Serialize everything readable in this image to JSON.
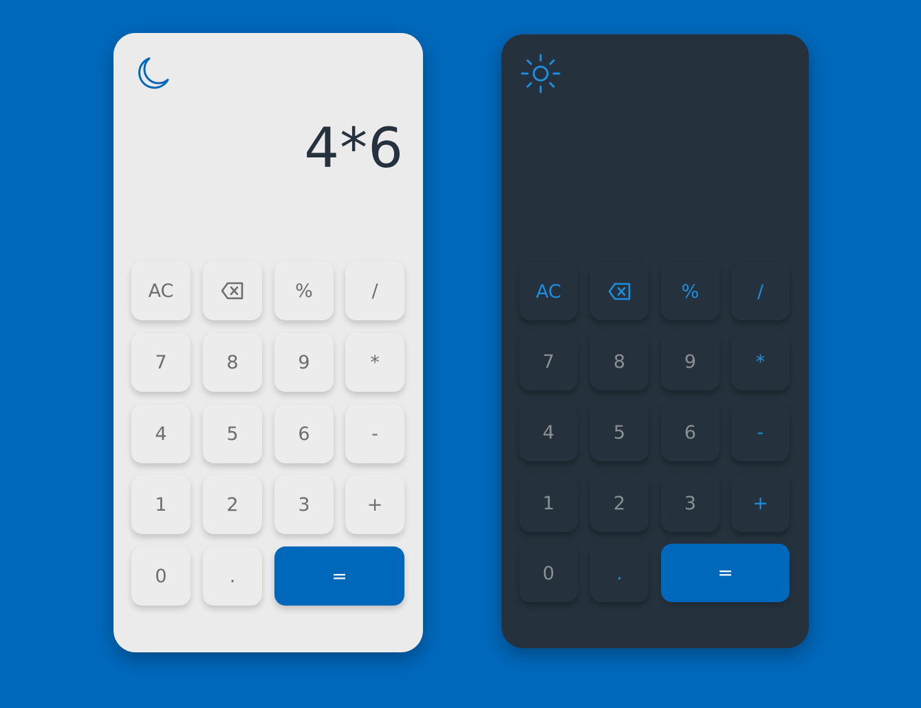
{
  "colors": {
    "background": "#0068bb",
    "light_panel": "#ebebeb",
    "dark_panel": "#25323d",
    "accent": "#0068bb",
    "dark_operator": "#1c8fe0"
  },
  "light_calculator": {
    "theme_icon": "moon-icon",
    "display": "4*6",
    "keys": {
      "ac": "AC",
      "backspace_icon": "backspace-icon",
      "percent": "%",
      "divide": "/",
      "seven": "7",
      "eight": "8",
      "nine": "9",
      "multiply": "*",
      "four": "4",
      "five": "5",
      "six": "6",
      "minus": "-",
      "one": "1",
      "two": "2",
      "three": "3",
      "plus": "+",
      "zero": "0",
      "dot": ".",
      "equals": "="
    }
  },
  "dark_calculator": {
    "theme_icon": "sun-icon",
    "display": "",
    "keys": {
      "ac": "AC",
      "backspace_icon": "backspace-icon",
      "percent": "%",
      "divide": "/",
      "seven": "7",
      "eight": "8",
      "nine": "9",
      "multiply": "*",
      "four": "4",
      "five": "5",
      "six": "6",
      "minus": "-",
      "one": "1",
      "two": "2",
      "three": "3",
      "plus": "+",
      "zero": "0",
      "dot": ".",
      "equals": "="
    }
  }
}
